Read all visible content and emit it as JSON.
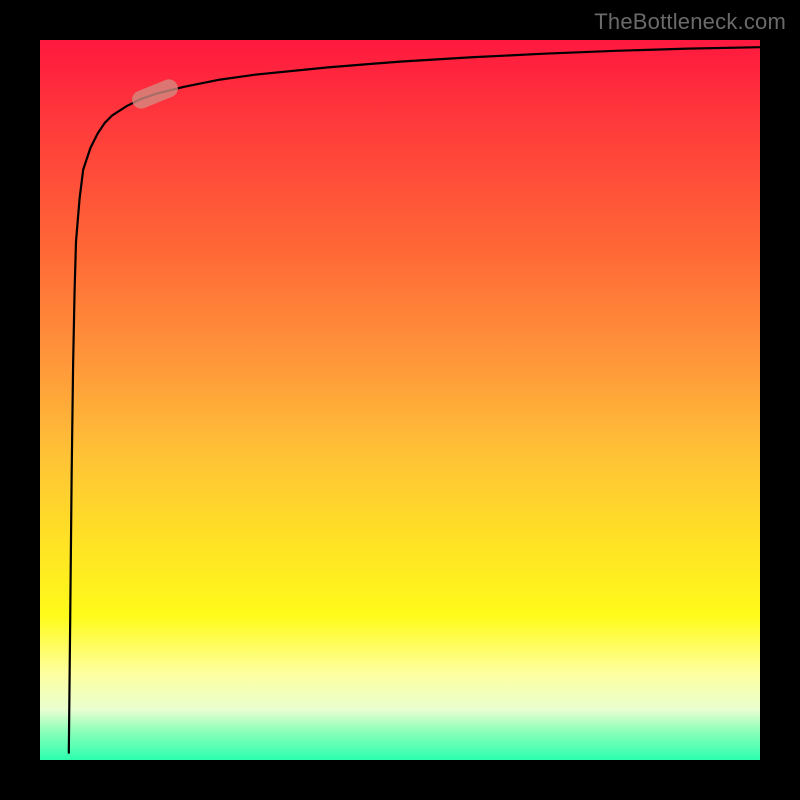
{
  "watermark": {
    "text": "TheBottleneck.com"
  },
  "colors": {
    "gradient_top": "#ff183f",
    "gradient_mid1": "#ff983a",
    "gradient_mid2": "#fffb1a",
    "gradient_bottom": "#2cffae",
    "curve_stroke": "#000000",
    "marker_fill": "rgba(212,140,129,0.78)",
    "frame": "#000000"
  },
  "chart_data": {
    "type": "line",
    "title": "",
    "xlabel": "",
    "ylabel": "",
    "xlim": [
      0,
      100
    ],
    "ylim": [
      0,
      100
    ],
    "grid": false,
    "legend": false,
    "notes": "Axes unlabeled; values are relative positions (0–100) inferred from pixel layout. Curve rises steeply from near origin then flattens approaching y≈100. A single highlighted segment (marker) sits on the curve near x≈16.",
    "series": [
      {
        "name": "curve",
        "x": [
          4.0,
          4.2,
          4.4,
          4.6,
          4.8,
          5.0,
          5.5,
          6.0,
          7.0,
          8.0,
          9.0,
          10,
          12,
          14,
          16,
          20,
          25,
          30,
          40,
          50,
          60,
          70,
          80,
          90,
          100
        ],
        "y": [
          1,
          20,
          40,
          55,
          65,
          72,
          78,
          82,
          85,
          87,
          88.5,
          89.5,
          90.8,
          91.8,
          92.5,
          93.5,
          94.5,
          95.2,
          96.2,
          97.0,
          97.6,
          98.1,
          98.5,
          98.8,
          99.0
        ]
      }
    ],
    "marker": {
      "name": "highlighted-segment",
      "x": 16,
      "y": 92.5,
      "angle_deg": -22
    }
  }
}
